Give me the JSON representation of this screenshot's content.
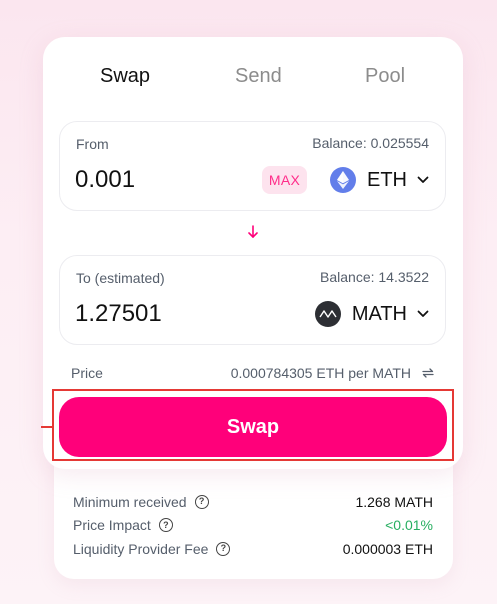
{
  "tabs": [
    {
      "label": "Swap",
      "active": true
    },
    {
      "label": "Send",
      "active": false
    },
    {
      "label": "Pool",
      "active": false
    }
  ],
  "from": {
    "label": "From",
    "balance": "Balance: 0.025554",
    "amount": "0.001",
    "max_label": "MAX",
    "token": "ETH",
    "token_icon": "eth-icon"
  },
  "to": {
    "label": "To (estimated)",
    "balance": "Balance: 14.3522",
    "amount": "1.27501",
    "token": "MATH",
    "token_icon": "math-icon"
  },
  "price": {
    "label": "Price",
    "value": "0.000784305 ETH per MATH"
  },
  "swap_button": {
    "label": "Swap"
  },
  "details": [
    {
      "label": "Minimum received",
      "value": "1.268 MATH",
      "status": "normal"
    },
    {
      "label": "Price Impact",
      "value": "<0.01%",
      "status": "good"
    },
    {
      "label": "Liquidity Provider Fee",
      "value": "0.000003 ETH",
      "status": "normal"
    }
  ],
  "colors": {
    "accent": "#ff007a",
    "max_bg": "#fde3ee",
    "max_text": "#ff2d8a",
    "positive": "#27ae60",
    "highlight": "#e53935"
  }
}
